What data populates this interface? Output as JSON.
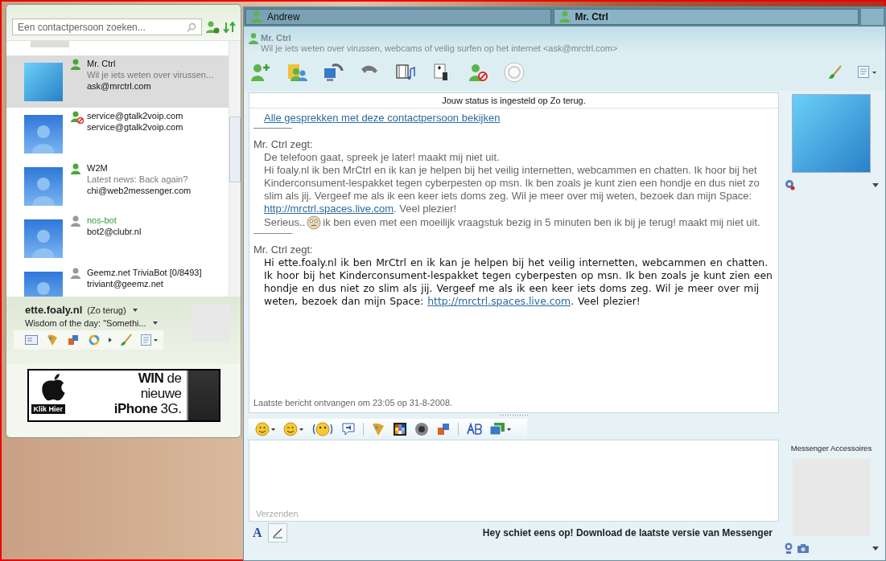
{
  "contact_list": {
    "search": {
      "placeholder": "Een contactpersoon zoeken..."
    },
    "contacts": [
      {
        "name": "Mr. Ctrl",
        "kind": "online",
        "personal_message": "Wil je iets weten over virussen...",
        "email": "ask@mrctrl.com",
        "selected": true,
        "highlighted": false,
        "has_photo": true
      },
      {
        "name": "service@gtalk2voip.com",
        "kind": "blocked",
        "email": "service@gtalk2voip.com",
        "selected": false,
        "highlighted": false,
        "has_photo": false
      },
      {
        "name": "W2M",
        "kind": "online",
        "personal_message": "Latest news: Back again?",
        "email": "chi@web2messenger.com",
        "selected": false,
        "highlighted": false,
        "has_photo": false
      },
      {
        "name": "nos-bot",
        "kind": "offline",
        "email": "bot2@clubr.nl",
        "selected": false,
        "highlighted": true,
        "has_photo": false
      },
      {
        "name": "Geemz.net TriviaBot [0/8493]",
        "kind": "offline",
        "email": "triviant@geemz.net",
        "selected": false,
        "highlighted": false,
        "has_photo": false
      }
    ]
  },
  "me": {
    "name": "ette.foaly.nl",
    "status": "(Zo terug)",
    "message": "Wisdom of the day: \"Somethi..."
  },
  "ad": {
    "headline": "**WIN** de",
    "line2": "nieuwe",
    "line3": "**iPhone** 3G.",
    "button": "Klik Hier"
  },
  "tabs": [
    {
      "label": "Andrew",
      "selected": false
    },
    {
      "label": "Mr. Ctrl",
      "selected": true
    }
  ],
  "chat_header": {
    "name": "Mr. Ctrl",
    "message": "Wil je iets weten over virussen, webcams of veilig surfen op het internet <ask@mrctrl.com>"
  },
  "status_notice": "Jouw status is ingesteld op Zo terug.",
  "history_link": "Alle gesprekken met deze contactpersoon bekijken",
  "messages": [
    {
      "sender": "Mr. Ctrl zegt:",
      "kind": "auto",
      "lines": [
        {
          "text": "De telefoon gaat, spreek je later! maakt mij niet uit."
        },
        {
          "text": "Hi foaly.nl ik ben MrCtrl en ik kan je helpen bij het veilig internetten, webcammen en chatten. Ik hoor bij het Kinderconsument-lespakket tegen cyberpesten op msn. Ik ben zoals je kunt zien een hondje en dus niet zo slim als jij. Vergeef me als ik een keer iets doms zeg. Wil je meer over mij weten, bezoek dan mijn Space:",
          "link": "http://mrctrl.spaces.live.com",
          "after": ". Veel plezier!"
        },
        {
          "text": "Serieus..",
          "emoticon": true,
          "after": "ik ben even met een moeilijk vraagstuk bezig in 5 minuten ben ik bij je terug! maakt mij niet uit."
        }
      ]
    },
    {
      "sender": "Mr. Ctrl zegt:",
      "kind": "normal",
      "lines": [
        {
          "text": "Hi ette.foaly.nl ik ben MrCtrl en ik kan je helpen bij het veilig internetten, webcammen en chatten. Ik hoor bij het Kinderconsument-lespakket tegen cyberpesten op msn. Ik ben zoals je kunt zien een hondje en dus niet zo slim als jij. Vergeef me als ik een keer iets doms zeg. Wil je meer over mij weten, bezoek dan mijn Space:",
          "link": "http://mrctrl.spaces.live.com",
          "after": ". Veel plezier!"
        }
      ]
    }
  ],
  "last_received": "Laatste bericht ontvangen om 23:05 op 31-8-2008.",
  "send_button": {
    "label": "Verzenden",
    "disabled": true
  },
  "font_button": "A",
  "footer_message": "Hey schiet eens op! Download de laatste versie van Messenger",
  "accessories_label": "Messenger Accessoires"
}
